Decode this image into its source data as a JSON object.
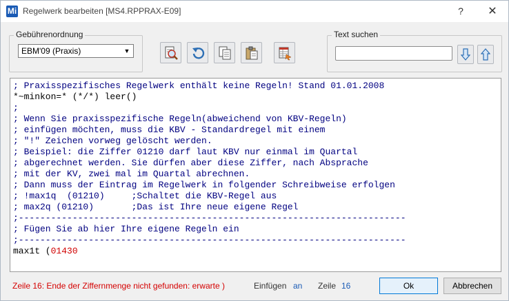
{
  "window": {
    "title": "Regelwerk bearbeiten [MS4.RPPRAX-E09]",
    "app_icon": "Mi",
    "help_label": "?",
    "close_label": "✕"
  },
  "gebuehrenordnung": {
    "label": "Gebührenordnung",
    "selected": "EBM'09 (Praxis)"
  },
  "toolbar": {
    "buttons": [
      {
        "icon": "search-document-icon"
      },
      {
        "icon": "undo-icon"
      },
      {
        "icon": "copy-icon"
      },
      {
        "icon": "paste-icon"
      },
      {
        "icon": "spreadsheet-export-icon"
      }
    ]
  },
  "text_search": {
    "label": "Text suchen",
    "value": "",
    "down_icon": "arrow-down-icon",
    "up_icon": "arrow-up-icon"
  },
  "editor": {
    "lines": [
      {
        "text": "; Praxisspezifisches Regelwerk enthält keine Regeln! Stand 01.01.2008",
        "type": "comment"
      },
      {
        "text": "*~minkon=* (*/*) leer()",
        "type": "code"
      },
      {
        "text": ";",
        "type": "comment"
      },
      {
        "text": "; Wenn Sie praxisspezifische Regeln(abweichend von KBV-Regeln)",
        "type": "comment"
      },
      {
        "text": "; einfügen möchten, muss die KBV - Standardregel mit einem",
        "type": "comment"
      },
      {
        "text": "; \"!\" Zeichen vorweg gelöscht werden.",
        "type": "comment"
      },
      {
        "text": "; Beispiel: die Ziffer 01210 darf laut KBV nur einmal im Quartal",
        "type": "comment"
      },
      {
        "text": "; abgerechnet werden. Sie dürfen aber diese Ziffer, nach Absprache",
        "type": "comment"
      },
      {
        "text": "; mit der KV, zwei mal im Quartal abrechnen.",
        "type": "comment"
      },
      {
        "text": "; Dann muss der Eintrag im Regelwerk in folgender Schreibweise erfolgen",
        "type": "comment"
      },
      {
        "text": "; !max1q  (01210)     ;Schaltet die KBV-Regel aus",
        "type": "comment"
      },
      {
        "text": "; max2q (01210)       ;Das ist Ihre neue eigene Regel",
        "type": "comment"
      },
      {
        "text": ";------------------------------------------------------------------------",
        "type": "comment"
      },
      {
        "text": "; Fügen Sie ab hier Ihre eigene Regeln ein",
        "type": "comment"
      },
      {
        "text": ";------------------------------------------------------------------------",
        "type": "comment"
      }
    ],
    "last_line_code": "max1t (",
    "last_line_error": "01430"
  },
  "status": {
    "error_message": "Zeile 16: Ende der Ziffernmenge nicht gefunden: erwarte )",
    "mode_label": "Einfügen",
    "mode_value": "an",
    "line_label": "Zeile",
    "line_value": "16"
  },
  "buttons": {
    "ok": "Ok",
    "cancel": "Abbrechen"
  }
}
